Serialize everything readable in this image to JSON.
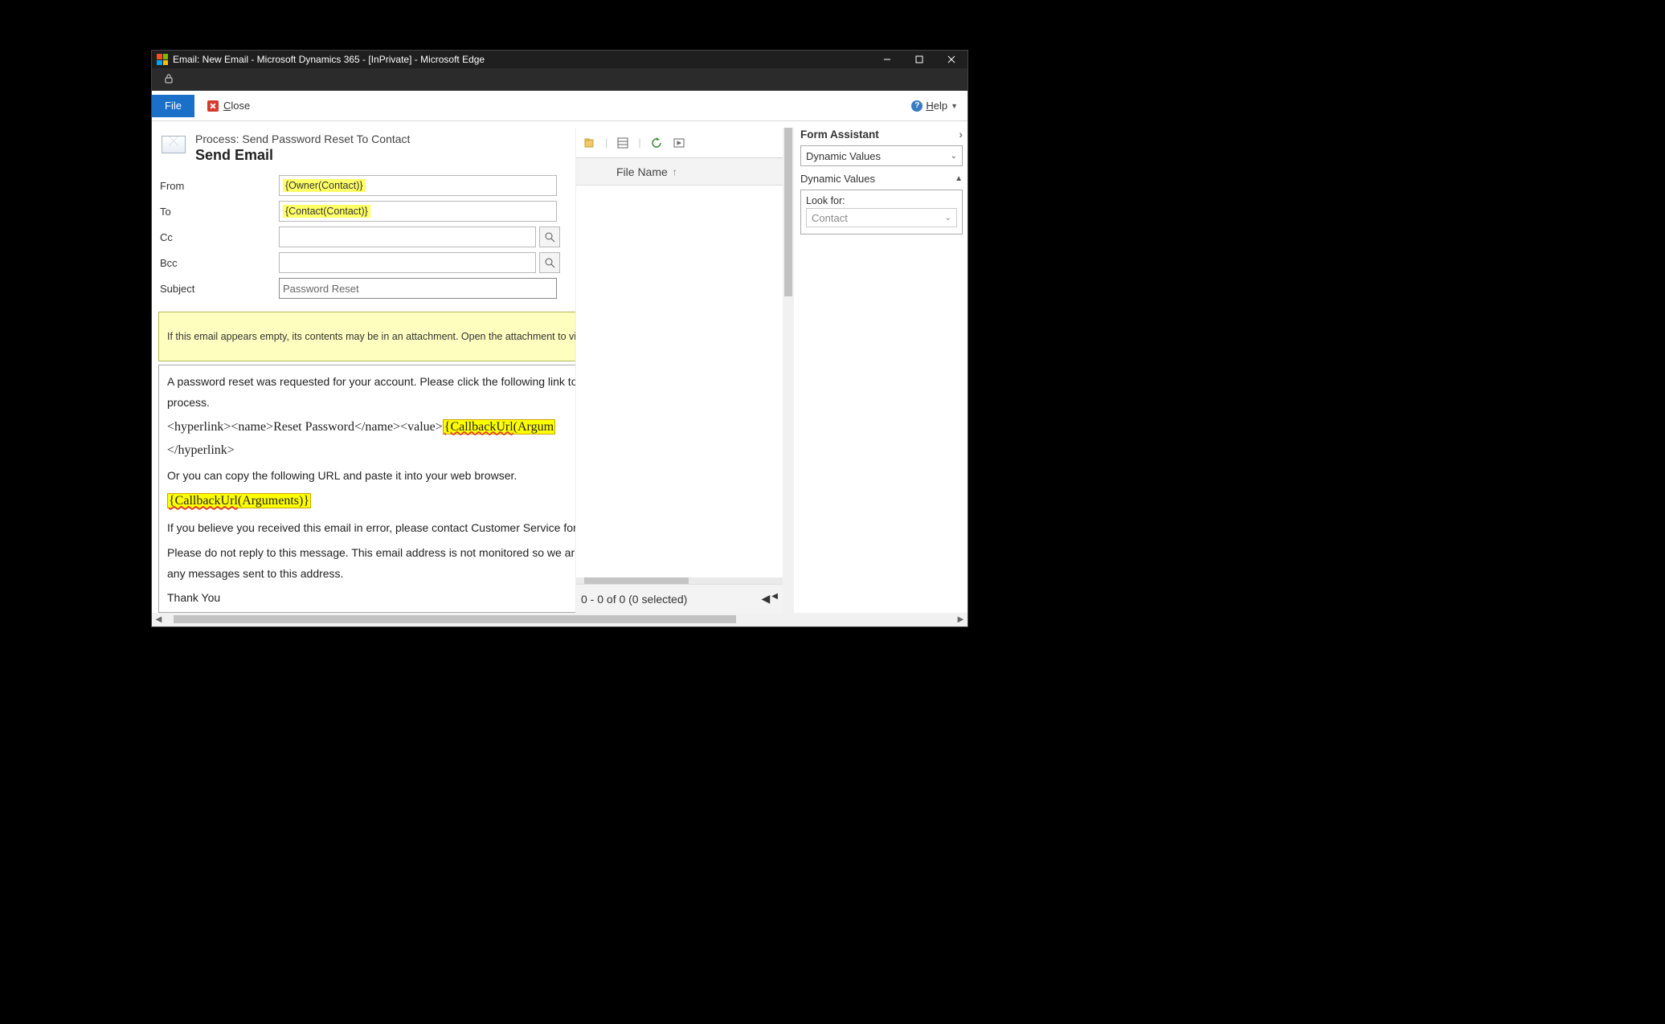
{
  "window": {
    "title": "Email: New Email - Microsoft Dynamics 365 - [InPrivate] - Microsoft Edge"
  },
  "ribbon": {
    "file_label": "File",
    "close_letter": "C",
    "close_rest": "lose",
    "help_letter": "H",
    "help_rest": "elp"
  },
  "header": {
    "process": "Process: Send Password Reset To Contact",
    "title": "Send Email"
  },
  "form": {
    "from_label": "From",
    "from_value": "{Owner(Contact)}",
    "to_label": "To",
    "to_value": "{Contact(Contact)}",
    "cc_label": "Cc",
    "bcc_label": "Bcc",
    "subject_label": "Subject",
    "subject_value": "Password Reset"
  },
  "empty_bar": "If this email appears empty, its contents may be in an attachment. Open the attachment to view the",
  "body": {
    "p1": "A password reset was requested for your account. Please click the following link to",
    "p1b": "process.",
    "hyper_pre": "<hyperlink><name>Reset Password</name><value>",
    "hyper_hl_wavy": "{CallbackUrl",
    "hyper_hl_rest": "(Argum",
    "hyper_close": "</hyperlink>",
    "p3": "Or you can copy the following URL and paste it into your web browser.",
    "cb_wavy": "{CallbackUrl",
    "cb_rest": "(Arguments)}",
    "p5": "If you believe you received this email in error, please contact Customer Service for",
    "p6": "Please do not reply to this message. This email address is not monitored so we ar",
    "p6b": "any messages sent to this address.",
    "p7": "Thank You"
  },
  "attachments": {
    "filename_header": "File Name",
    "status": "0 - 0 of 0 (0 selected)"
  },
  "assistant": {
    "title": "Form Assistant",
    "dropdown": "Dynamic Values",
    "subhead": "Dynamic Values",
    "look_for_label": "Look for:",
    "look_for_value": "Contact"
  }
}
